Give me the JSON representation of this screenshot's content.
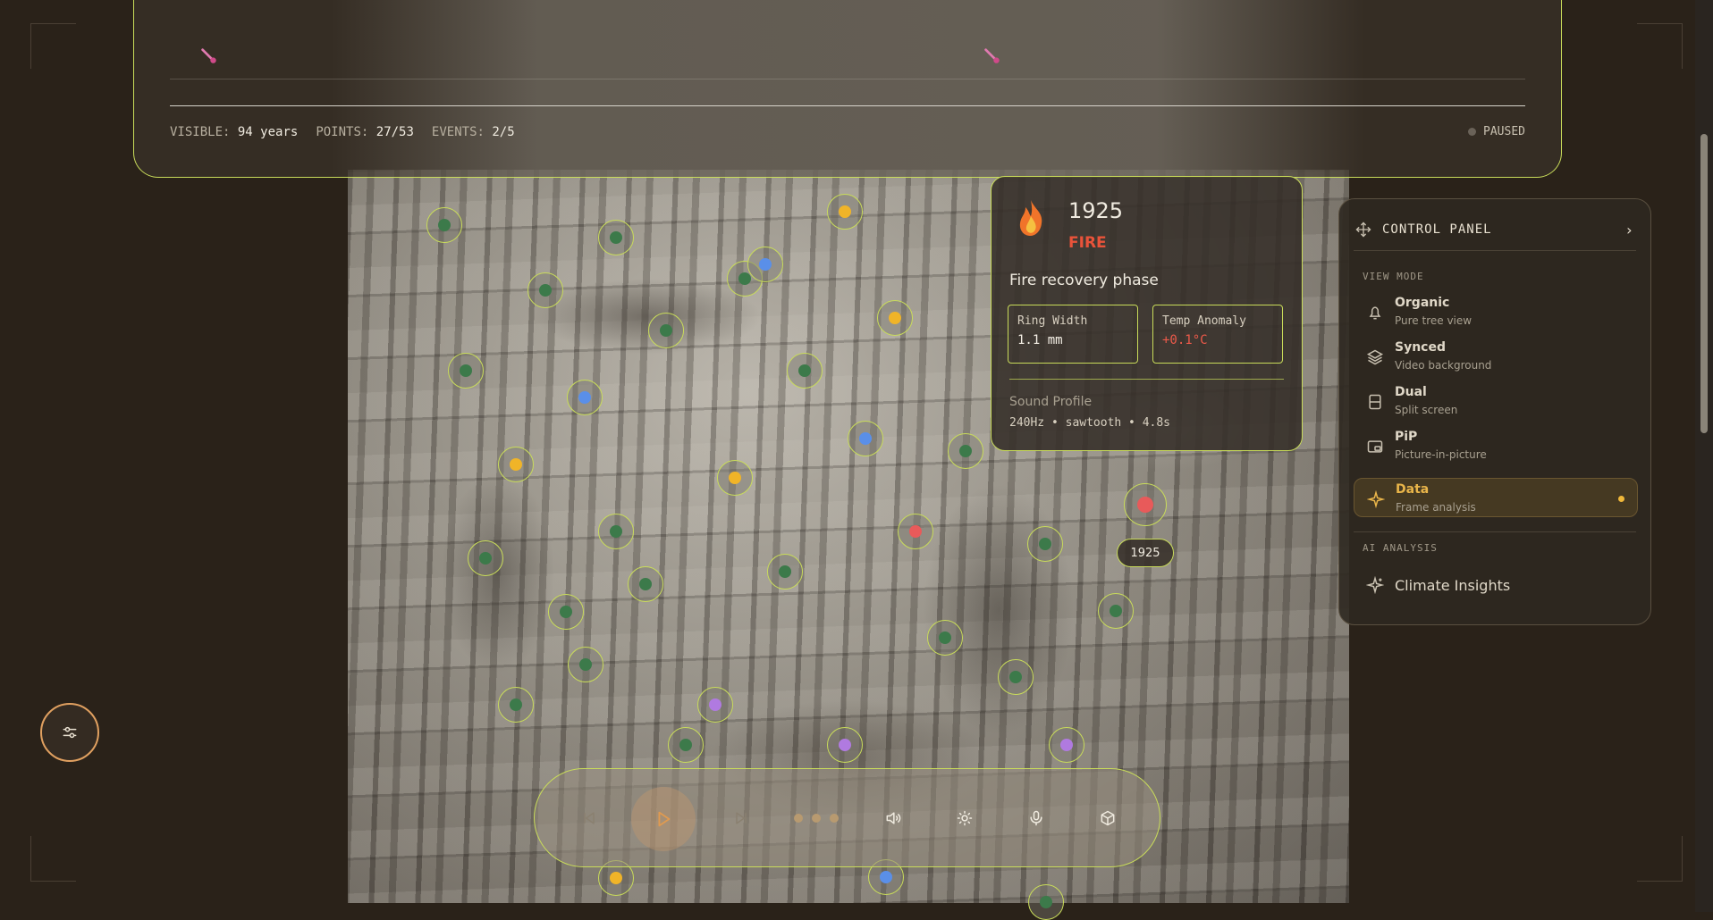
{
  "header": {
    "stats": [
      {
        "label": "VISIBLE:",
        "value": "94 years"
      },
      {
        "label": "POINTS:",
        "value": "27/53"
      },
      {
        "label": "EVENTS:",
        "value": "2/5"
      }
    ],
    "status": "PAUSED"
  },
  "event_card": {
    "year": "1925",
    "type": "FIRE",
    "type_color": "#e9533a",
    "description": "Fire recovery phase",
    "metrics": [
      {
        "label": "Ring Width",
        "value": "1.1 mm"
      },
      {
        "label": "Temp Anomaly",
        "value": "+0.1°C"
      }
    ],
    "sound_label": "Sound Profile",
    "sound_value": "240Hz • sawtooth • 4.8s"
  },
  "marker_year": "1925",
  "control_panel": {
    "title": "CONTROL PANEL",
    "view_mode_label": "VIEW MODE",
    "modes": [
      {
        "title": "Organic",
        "subtitle": "Pure tree view",
        "icon": "bell-icon"
      },
      {
        "title": "Synced",
        "subtitle": "Video background",
        "icon": "layers-icon"
      },
      {
        "title": "Dual",
        "subtitle": "Split screen",
        "icon": "split-icon"
      },
      {
        "title": "PiP",
        "subtitle": "Picture-in-picture",
        "icon": "pip-icon"
      },
      {
        "title": "Data",
        "subtitle": "Frame analysis",
        "icon": "sparkle-icon",
        "active": true
      }
    ],
    "ai_label": "AI ANALYSIS",
    "ai_item": "Climate Insights"
  },
  "colors": {
    "accent": "#c9dc5a",
    "active": "#e9b54a",
    "fire": "#e9533a",
    "green_point": "#3c7a4a",
    "blue_point": "#5a8fe8",
    "yellow_point": "#f0b428",
    "purple_point": "#b07ae0",
    "red_point": "#e85a5a"
  }
}
